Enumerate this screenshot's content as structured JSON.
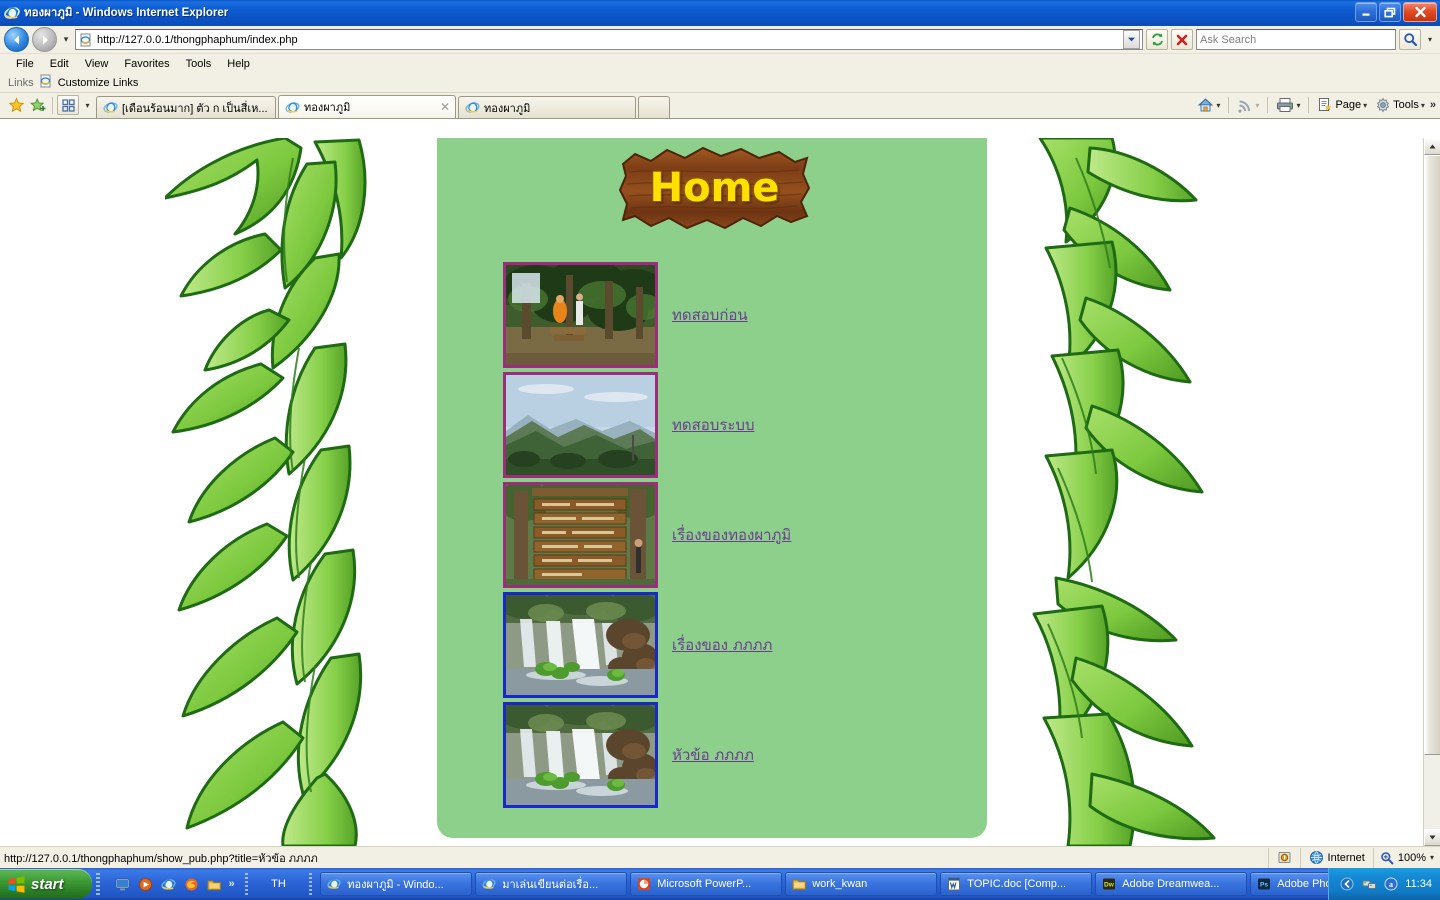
{
  "window": {
    "title": "ทองผาภูมิ - Windows Internet Explorer",
    "minimize_label": "Minimize",
    "restore_label": "Restore",
    "close_label": "Close"
  },
  "address_bar": {
    "url": "http://127.0.0.1/thongphaphum/index.php",
    "back_label": "Back",
    "forward_label": "Forward",
    "history_caret": "▾",
    "dropdown_caret": "▾",
    "refresh_label": "Refresh",
    "stop_label": "Stop",
    "search_placeholder": "Ask Search",
    "search_caret": "▾"
  },
  "menu": {
    "items": [
      "File",
      "Edit",
      "View",
      "Favorites",
      "Tools",
      "Help"
    ]
  },
  "links_bar": {
    "label": "Links",
    "customize": "Customize Links"
  },
  "tabs": {
    "quicktab_caret": "▾",
    "items": [
      {
        "label": "[เดือนร้อนมาก] ตัว ก เป็นสี่เห...",
        "active": false,
        "closable": false
      },
      {
        "label": "ทองผาภูมิ",
        "active": true,
        "closable": true
      },
      {
        "label": "ทองผาภูมิ",
        "active": false,
        "closable": false
      }
    ],
    "new_tab_label": "",
    "right_tools": {
      "home_label": "",
      "home_caret": "▾",
      "feeds_label": "",
      "feeds_caret": "▾",
      "print_label": "",
      "print_caret": "▾",
      "page_label": "Page",
      "page_caret": "▾",
      "tools_label": "Tools",
      "tools_caret": "▾",
      "overflow": "»"
    }
  },
  "page": {
    "background_color": "#ffffff",
    "panel_color": "#8cd08c",
    "banner_text": "Home",
    "banner_text_color": "#ffe000",
    "link_color": "#6b3f8e",
    "items": [
      {
        "link_text": "ทดสอบก่อน",
        "border_color": "#9c2d7c",
        "image_name": "tree-canopy-photo"
      },
      {
        "link_text": "ทดสอบระบบ",
        "border_color": "#9c2d7c",
        "image_name": "mountain-view-photo"
      },
      {
        "link_text": "เรื่องของทองผาภูมิ",
        "border_color": "#9c2d7c",
        "image_name": "wooden-signpost-photo"
      },
      {
        "link_text": "เรื่องของ ภภภภ",
        "border_color": "#1a28c8",
        "image_name": "waterfall-photo"
      },
      {
        "link_text": "หัวข้อ ภภภภ",
        "border_color": "#1a28c8",
        "image_name": "waterfall-photo"
      }
    ]
  },
  "status_bar": {
    "url": "http://127.0.0.1/thongphaphum/show_pub.php?title=หัวข้อ ภภภภ",
    "zone": "Internet",
    "zoom": "100%",
    "zoom_caret": "▾"
  },
  "taskbar": {
    "start_label": "start",
    "quick_launch": [
      "show-desktop-icon",
      "media-player-icon",
      "internet-explorer-icon",
      "firefox-icon",
      "folder-icon"
    ],
    "quick_launch_overflow": "»",
    "language": "TH",
    "buttons": [
      {
        "label": "ทองผาภูมิ - Windo...",
        "icon": "internet-explorer-icon"
      },
      {
        "label": "มาเล่นเขียนต่อเรื่อ...",
        "icon": "internet-explorer-icon"
      },
      {
        "label": "Microsoft PowerP...",
        "icon": "powerpoint-icon"
      },
      {
        "label": "work_kwan",
        "icon": "folder-icon"
      },
      {
        "label": "TOPIC.doc [Comp...",
        "icon": "word-icon"
      },
      {
        "label": "Adobe Dreamwea...",
        "icon": "dreamweaver-icon"
      },
      {
        "label": "Adobe Photoshop...",
        "icon": "photoshop-icon"
      }
    ],
    "tray_icons": [
      "show-hidden-icons",
      "network-icon",
      "security-icon"
    ],
    "clock": "11:34"
  }
}
